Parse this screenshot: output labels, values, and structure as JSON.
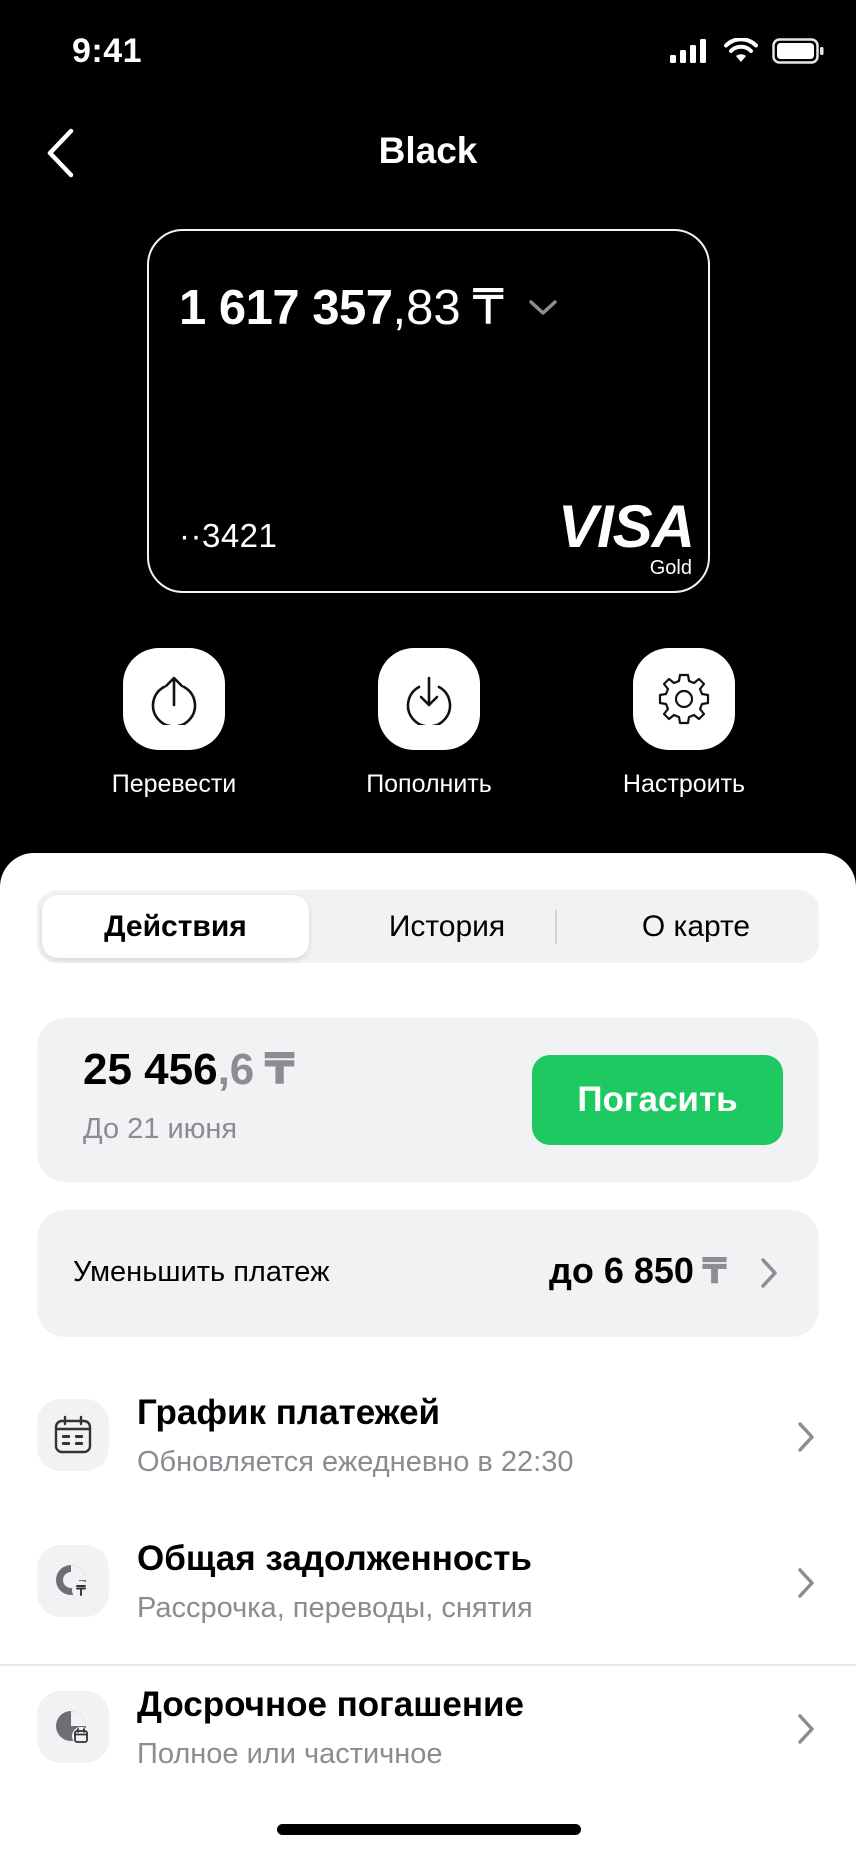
{
  "status_bar": {
    "time": "9:41"
  },
  "nav": {
    "title": "Black"
  },
  "card": {
    "balance_int": "1 617 357",
    "balance_frac": ",83",
    "currency": "₸",
    "number": "··3421",
    "brand": "VISA",
    "brand_sub": "Gold"
  },
  "actions": [
    {
      "label": "Перевести",
      "icon": "upload-arrow-icon"
    },
    {
      "label": "Пополнить",
      "icon": "download-arrow-icon"
    },
    {
      "label": "Настроить",
      "icon": "gear-icon"
    }
  ],
  "tabs": [
    {
      "label": "Действия",
      "active": true
    },
    {
      "label": "История",
      "active": false
    },
    {
      "label": "О карте",
      "active": false
    }
  ],
  "payment": {
    "amount_int": "25 456",
    "amount_frac": ",6",
    "currency": "₸",
    "due": "До 21 июня",
    "button": "Погасить"
  },
  "reduce": {
    "label": "Уменьшить платеж",
    "value": "до 6 850",
    "currency": "₸"
  },
  "list": [
    {
      "title": "График платежей",
      "subtitle": "Обновляется ежедневно в 22:30",
      "icon": "calendar-icon"
    },
    {
      "title": "Общая задолженность",
      "subtitle": "Рассрочка, переводы, снятия",
      "icon": "debt-pie-icon"
    },
    {
      "title": "Досрочное погашение",
      "subtitle": "Полное или частичное",
      "icon": "early-repayment-icon"
    }
  ],
  "colors": {
    "accent_green": "#1dc960",
    "sheet_gray": "#f1f2f4",
    "secondary_text": "#8a8c91"
  }
}
